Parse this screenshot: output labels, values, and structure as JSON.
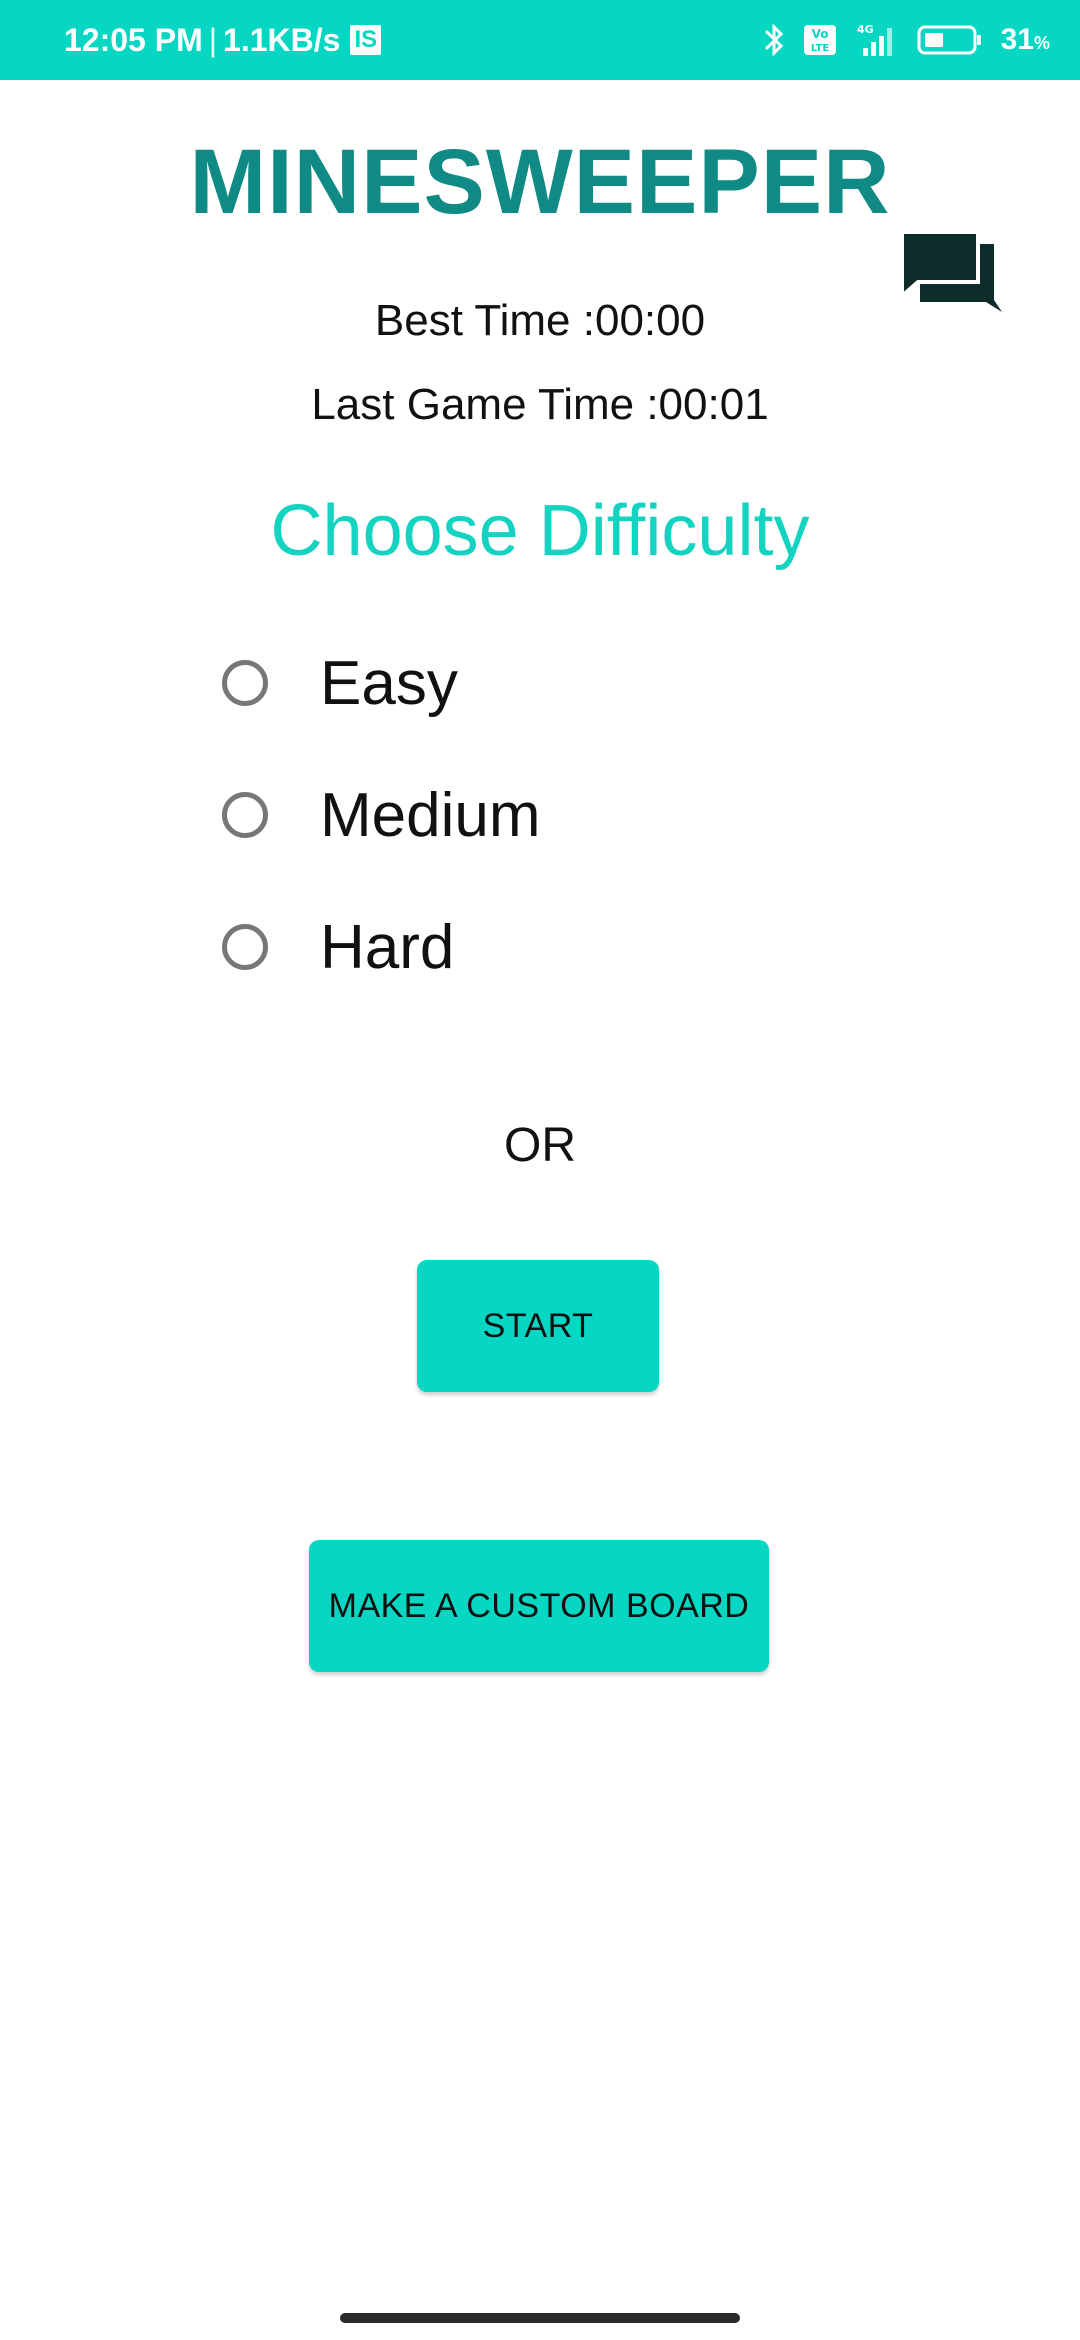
{
  "status_bar": {
    "time": "12:05 PM",
    "separator": "|",
    "network_speed": "1.1KB/s",
    "notification_badge": "IS",
    "battery_percent": "31",
    "battery_unit": "%",
    "icons": [
      "bluetooth-icon",
      "volte-icon",
      "signal-4g-icon",
      "battery-icon"
    ],
    "color": "#06d6c2"
  },
  "header": {
    "title": "MINESWEEPER",
    "help_icon": "question-answer-icon"
  },
  "stats": {
    "best_time": "Best Time :00:00",
    "last_game_time": "Last Game Time :00:01"
  },
  "difficulty": {
    "heading": "Choose Difficulty",
    "options": [
      {
        "label": "Easy",
        "selected": false
      },
      {
        "label": "Medium",
        "selected": false
      },
      {
        "label": "Hard",
        "selected": false
      }
    ]
  },
  "actions": {
    "or_text": "OR",
    "start_label": "START",
    "custom_board_label": "MAKE A CUSTOM BOARD"
  },
  "colors": {
    "accent": "#06d6c2",
    "title": "#0f8a84",
    "heading": "#14d3c1"
  }
}
